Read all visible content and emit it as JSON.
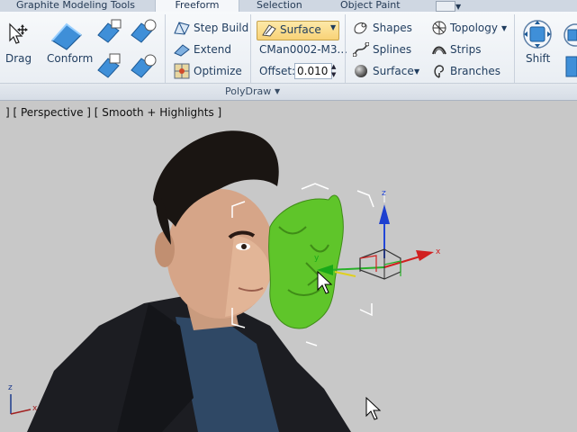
{
  "tabs": {
    "graphite": "Graphite Modeling Tools",
    "freeform": "Freeform",
    "selection": "Selection",
    "object_paint": "Object Paint"
  },
  "ribbon": {
    "drag": "Drag",
    "conform": "Conform",
    "step_build": "Step Build",
    "extend": "Extend",
    "optimize": "Optimize",
    "surface_button": "Surface",
    "object_name": "CMan0002-M3...",
    "offset_label": "Offset:",
    "offset_value": "0.010",
    "shapes": "Shapes",
    "splines": "Splines",
    "surface": "Surface",
    "topology": "Topology",
    "strips": "Strips",
    "branches": "Branches",
    "shift": "Shift",
    "group_label": "PolyDraw"
  },
  "viewport": {
    "label": "] [ Perspective ] [ Smooth + Highlights ]",
    "gizmo": {
      "z": "z",
      "x": "x",
      "y": "y"
    },
    "axis_tripod": {
      "z": "z",
      "x": "x"
    }
  },
  "colors": {
    "active_button": "#f8d277",
    "mask_green": "#5fc52a",
    "viewport_bg": "#c8c8c8"
  }
}
